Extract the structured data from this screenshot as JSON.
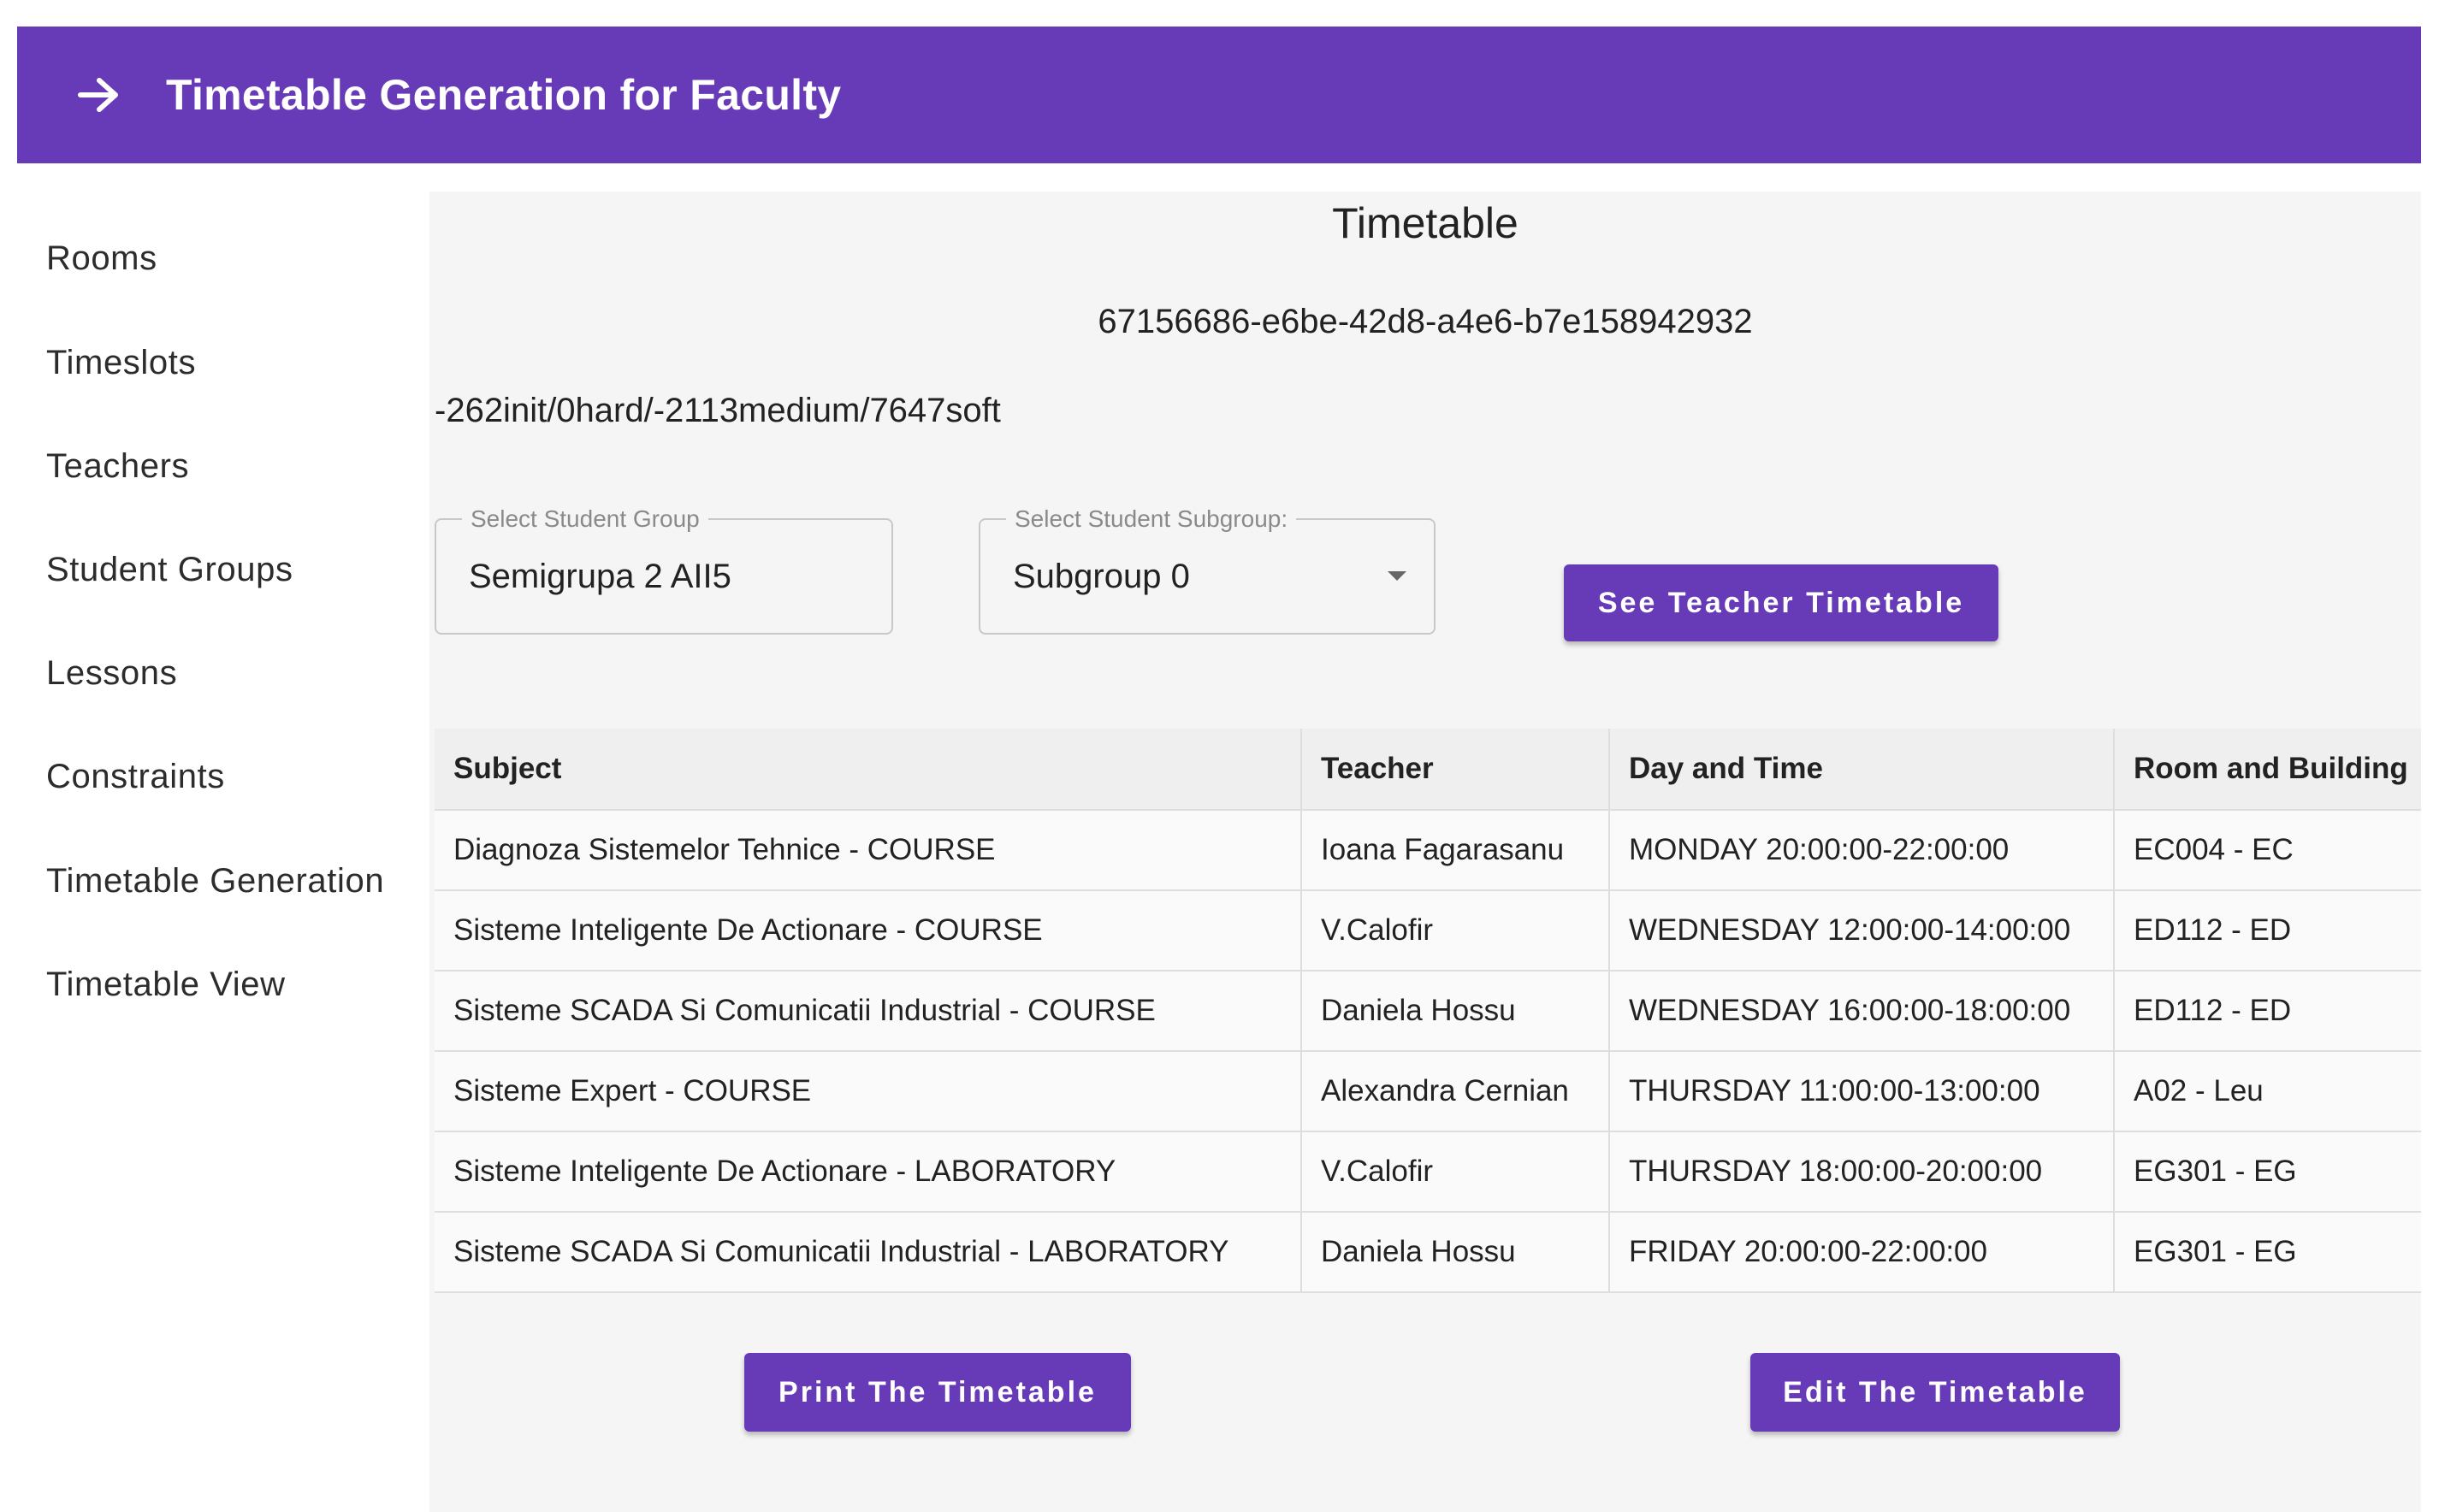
{
  "appbar": {
    "title": "Timetable Generation for Faculty",
    "icon": "arrow-right-icon"
  },
  "sidebar": {
    "items": [
      {
        "label": "Rooms"
      },
      {
        "label": "Timeslots"
      },
      {
        "label": "Teachers"
      },
      {
        "label": "Student Groups"
      },
      {
        "label": "Lessons"
      },
      {
        "label": "Constraints"
      },
      {
        "label": "Timetable Generation"
      },
      {
        "label": "Timetable View"
      }
    ]
  },
  "main": {
    "title": "Timetable",
    "timetable_id": "67156686-e6be-42d8-a4e6-b7e158942932",
    "score": "-262init/0hard/-2113medium/7647soft",
    "group_select": {
      "label": "Select Student Group",
      "value": "Semigrupa 2 AII5"
    },
    "subgroup_select": {
      "label": "Select Student Subgroup:",
      "value": "Subgroup 0"
    },
    "see_teacher_button": "See Teacher Timetable",
    "table": {
      "headers": [
        "Subject",
        "Teacher",
        "Day and Time",
        "Room and Building"
      ],
      "rows": [
        [
          "Diagnoza Sistemelor Tehnice - COURSE",
          "Ioana Fagarasanu",
          "MONDAY 20:00:00-22:00:00",
          "EC004 - EC"
        ],
        [
          "Sisteme Inteligente De Actionare - COURSE",
          "V.Calofir",
          "WEDNESDAY 12:00:00-14:00:00",
          "ED112 - ED"
        ],
        [
          "Sisteme SCADA Si Comunicatii Industrial - COURSE",
          "Daniela Hossu",
          "WEDNESDAY 16:00:00-18:00:00",
          "ED112 - ED"
        ],
        [
          "Sisteme Expert - COURSE",
          "Alexandra Cernian",
          "THURSDAY 11:00:00-13:00:00",
          "A02 - Leu"
        ],
        [
          "Sisteme Inteligente De Actionare - LABORATORY",
          "V.Calofir",
          "THURSDAY 18:00:00-20:00:00",
          "EG301 - EG"
        ],
        [
          "Sisteme SCADA Si Comunicatii Industrial - LABORATORY",
          "Daniela Hossu",
          "FRIDAY 20:00:00-22:00:00",
          "EG301 - EG"
        ]
      ]
    },
    "print_button": "Print The Timetable",
    "edit_button": "Edit The Timetable"
  },
  "colors": {
    "primary": "#673ab7",
    "background": "#f5f5f5"
  }
}
